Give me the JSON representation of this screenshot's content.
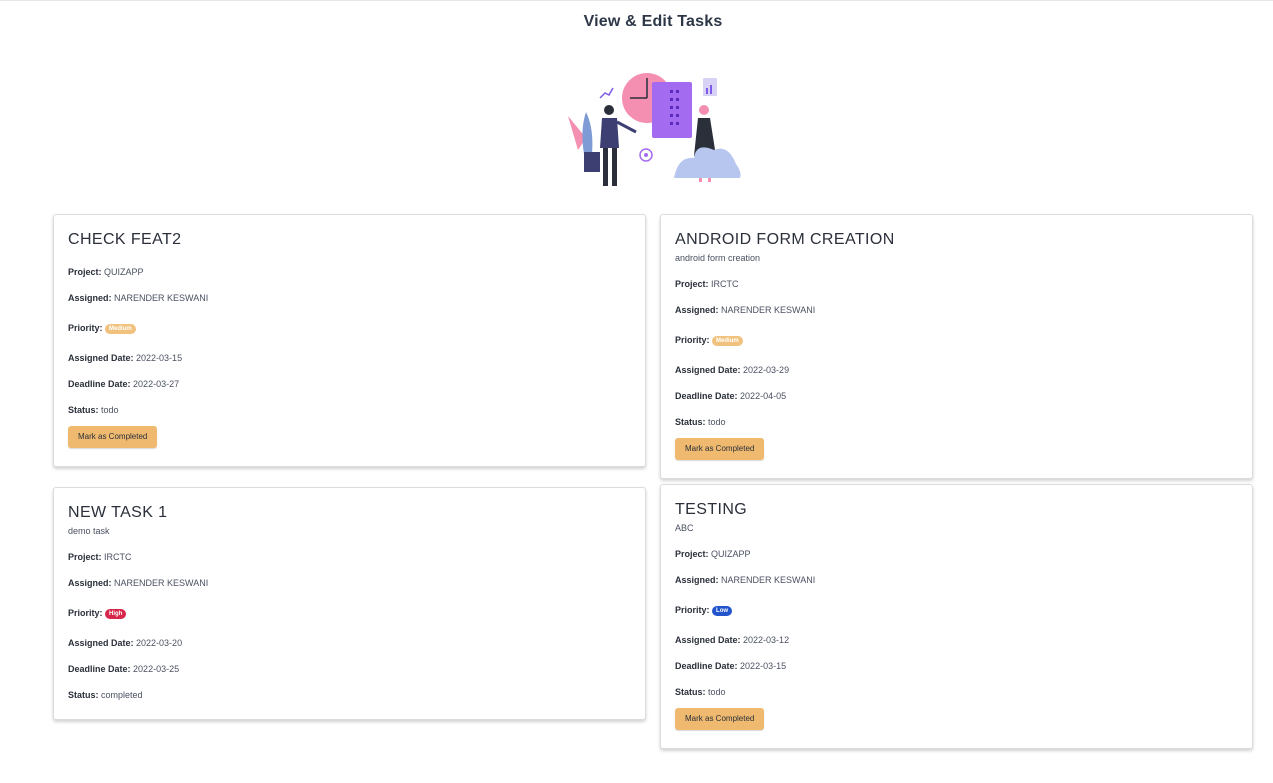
{
  "page": {
    "title": "View & Edit Tasks"
  },
  "colors": {
    "accent_button": "#efba6f",
    "priority_medium": "#f1c27d",
    "priority_high": "#d6264a",
    "priority_low": "#2255cc"
  },
  "labels": {
    "project": "Project:",
    "assigned": "Assigned:",
    "priority": "Priority:",
    "assigned_date": "Assigned Date:",
    "deadline_date": "Deadline Date:",
    "status": "Status:"
  },
  "tasks": [
    {
      "title": "CHECK FEAT2",
      "description": "",
      "project": "QUIZAPP",
      "assigned": "NARENDER KESWANI",
      "priority": "Medium",
      "assigned_date": "2022-03-15",
      "deadline_date": "2022-03-27",
      "status": "todo",
      "button": "Mark as Completed"
    },
    {
      "title": "ANDROID FORM CREATION",
      "description": "android form creation",
      "project": "IRCTC",
      "assigned": "NARENDER KESWANI",
      "priority": "Medium",
      "assigned_date": "2022-03-29",
      "deadline_date": "2022-04-05",
      "status": "todo",
      "button": "Mark as Completed"
    },
    {
      "title": "NEW TASK 1",
      "description": "demo task",
      "project": "IRCTC",
      "assigned": "NARENDER KESWANI",
      "priority": "High",
      "assigned_date": "2022-03-20",
      "deadline_date": "2022-03-25",
      "status": "completed"
    },
    {
      "title": "TESTING",
      "description": "ABC",
      "project": "QUIZAPP",
      "assigned": "NARENDER KESWANI",
      "priority": "Low",
      "assigned_date": "2022-03-12",
      "deadline_date": "2022-03-15",
      "status": "todo",
      "button": "Mark as Completed"
    }
  ],
  "illustration": {
    "icon": "team-planning-illustration"
  }
}
